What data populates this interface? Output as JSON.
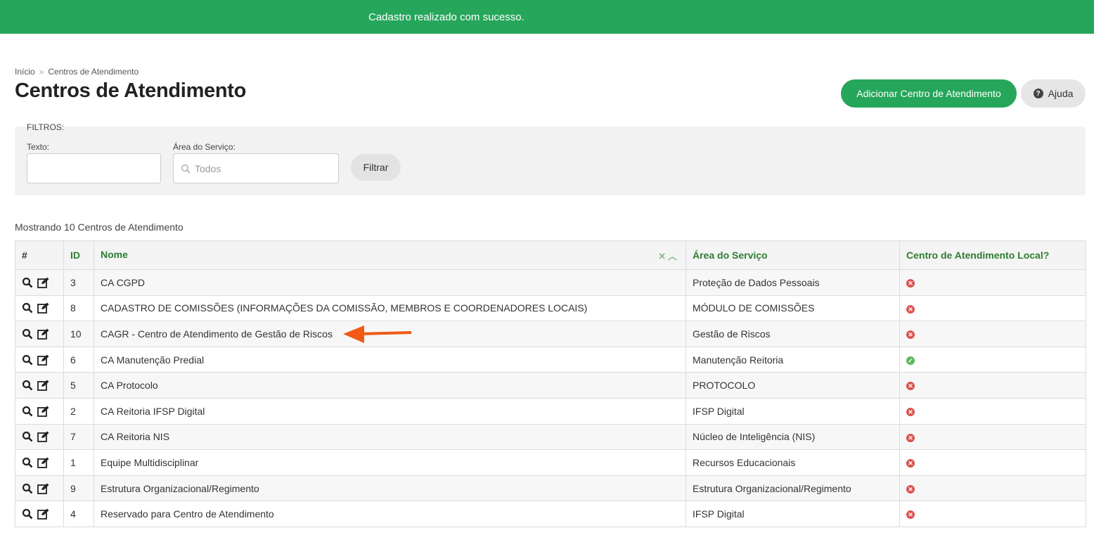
{
  "notification": {
    "message": "Cadastro realizado com sucesso."
  },
  "breadcrumb": {
    "home": "Início",
    "separator": "»",
    "current": "Centros de Atendimento"
  },
  "page": {
    "title": "Centros de Atendimento"
  },
  "toolbar": {
    "add_label": "Adicionar Centro de Atendimento",
    "help_label": "Ajuda"
  },
  "filters": {
    "title": "FILTROS:",
    "text_label": "Texto:",
    "text_value": "",
    "area_label": "Área do Serviço:",
    "area_placeholder": "Todos",
    "submit_label": "Filtrar"
  },
  "results": {
    "count_text": "Mostrando 10 Centros de Atendimento"
  },
  "table": {
    "headers": {
      "hash": "#",
      "id": "ID",
      "name": "Nome",
      "area": "Área do Serviço",
      "local": "Centro de Atendimento Local?"
    },
    "rows": [
      {
        "id": "3",
        "name": "CA CGPD",
        "area": "Proteção de Dados Pessoais",
        "local": false
      },
      {
        "id": "8",
        "name": "CADASTRO DE COMISSÕES (INFORMAÇÕES DA COMISSÃO, MEMBROS E COORDENADORES LOCAIS)",
        "area": "MÓDULO DE COMISSÕES",
        "local": false
      },
      {
        "id": "10",
        "name": "CAGR - Centro de Atendimento de Gestão de Riscos",
        "area": "Gestão de Riscos",
        "local": false
      },
      {
        "id": "6",
        "name": "CA Manutenção Predial",
        "area": "Manutenção Reitoria",
        "local": true
      },
      {
        "id": "5",
        "name": "CA Protocolo",
        "area": "PROTOCOLO",
        "local": false
      },
      {
        "id": "2",
        "name": "CA Reitoria IFSP Digital",
        "area": "IFSP Digital",
        "local": false
      },
      {
        "id": "7",
        "name": "CA Reitoria NIS",
        "area": "Núcleo de Inteligência (NIS)",
        "local": false
      },
      {
        "id": "1",
        "name": "Equipe Multidisciplinar",
        "area": "Recursos Educacionais",
        "local": false
      },
      {
        "id": "9",
        "name": "Estrutura Organizacional/Regimento",
        "area": "Estrutura Organizacional/Regimento",
        "local": false
      },
      {
        "id": "4",
        "name": "Reservado para Centro de Atendimento",
        "area": "IFSP Digital",
        "local": false
      }
    ]
  },
  "icons": {
    "view": "search-icon",
    "edit": "edit-icon",
    "yes": "check-circle-icon",
    "no": "x-circle-icon",
    "sort_clear": "close-icon",
    "sort": "chevron-up-icon",
    "annotation": "arrow-left-icon"
  },
  "colors": {
    "primary": "#26a65b",
    "header_text": "#2e7d32",
    "no": "#d9534f",
    "yes": "#5cb85c",
    "annotation_arrow": "#f05a14"
  }
}
